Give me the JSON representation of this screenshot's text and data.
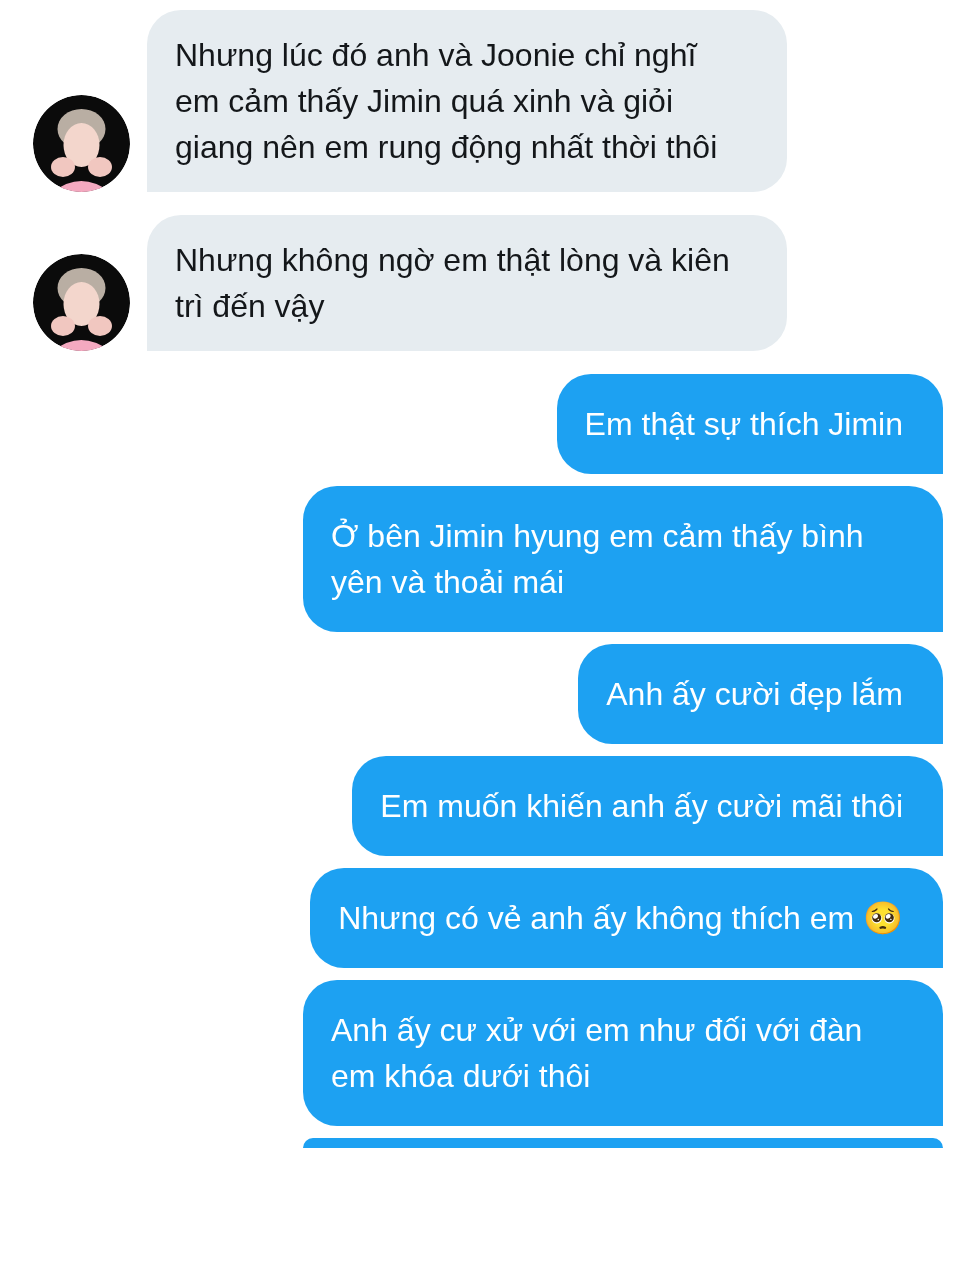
{
  "messages": [
    {
      "kind": "received",
      "avatar": true,
      "text": "Nhưng lúc đó anh và Joonie chỉ nghĩ em cảm thấy Jimin quá xinh và giỏi giang nên em rung động nhất thời thôi"
    },
    {
      "kind": "received",
      "avatar": true,
      "text": "Nhưng không ngờ em thật lòng và kiên trì đến vậy"
    },
    {
      "kind": "sent",
      "text": "Em thật sự thích Jimin"
    },
    {
      "kind": "sent",
      "text": "Ở bên Jimin hyung em cảm thấy bình yên và thoải mái"
    },
    {
      "kind": "sent",
      "text": "Anh ấy cười đẹp lắm"
    },
    {
      "kind": "sent",
      "text": "Em muốn khiến anh ấy cười mãi thôi"
    },
    {
      "kind": "sent",
      "text": "Nhưng có vẻ anh ấy không thích em 🥺"
    },
    {
      "kind": "sent",
      "text": "Anh ấy cư xử với em như đối với đàn em khóa dưới thôi"
    },
    {
      "kind": "sent_cut"
    }
  ]
}
